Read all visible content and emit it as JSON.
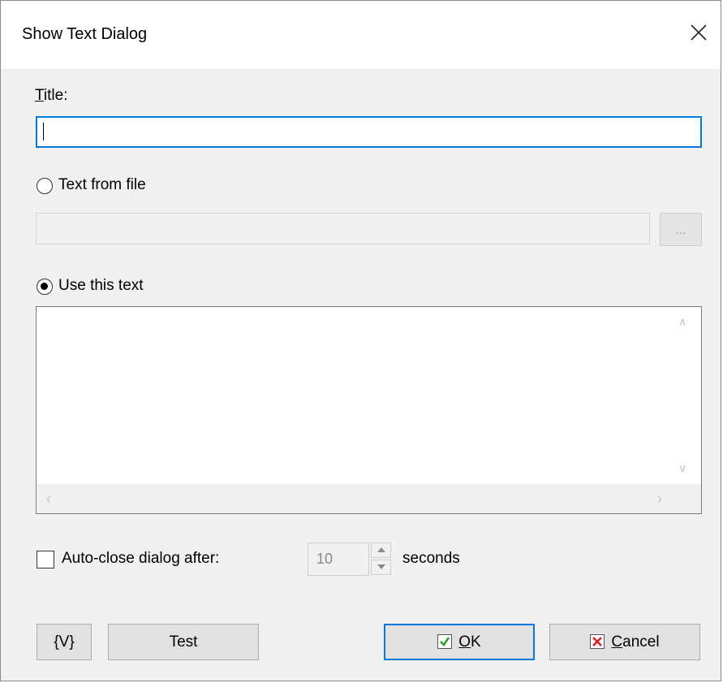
{
  "window": {
    "title": "Show Text Dialog"
  },
  "title_field": {
    "label_acc": "T",
    "label_rest": "itle:",
    "value": ""
  },
  "text_from_file": {
    "label": "Text from file",
    "selected": false,
    "path_value": "",
    "browse_label": "..."
  },
  "use_this_text": {
    "label": "Use this text",
    "selected": true,
    "content": ""
  },
  "auto_close": {
    "label": "Auto-close dialog after:",
    "checked": false,
    "value": "10",
    "unit": "seconds"
  },
  "buttons": {
    "variables": "{V}",
    "test": "Test",
    "ok_acc": "O",
    "ok_rest": "K",
    "cancel_acc": "C",
    "cancel_rest": "ancel"
  },
  "colors": {
    "accent": "#0078d7",
    "ok_check": "#2e9e2e",
    "cancel_x": "#d0202a"
  },
  "icons": {
    "close": "close-icon",
    "ok": "checkmark-icon",
    "cancel": "x-icon"
  }
}
